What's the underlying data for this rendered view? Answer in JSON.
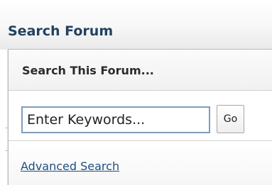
{
  "header": {
    "title": "Search Forum"
  },
  "popup": {
    "title": "Search This Forum...",
    "keywords_placeholder": "Enter Keywords...",
    "go_label": "Go",
    "advanced_link": "Advanced Search"
  },
  "colors": {
    "header_title": "#22415f",
    "link": "#1f4e7f",
    "input_border": "#7f9db9"
  }
}
